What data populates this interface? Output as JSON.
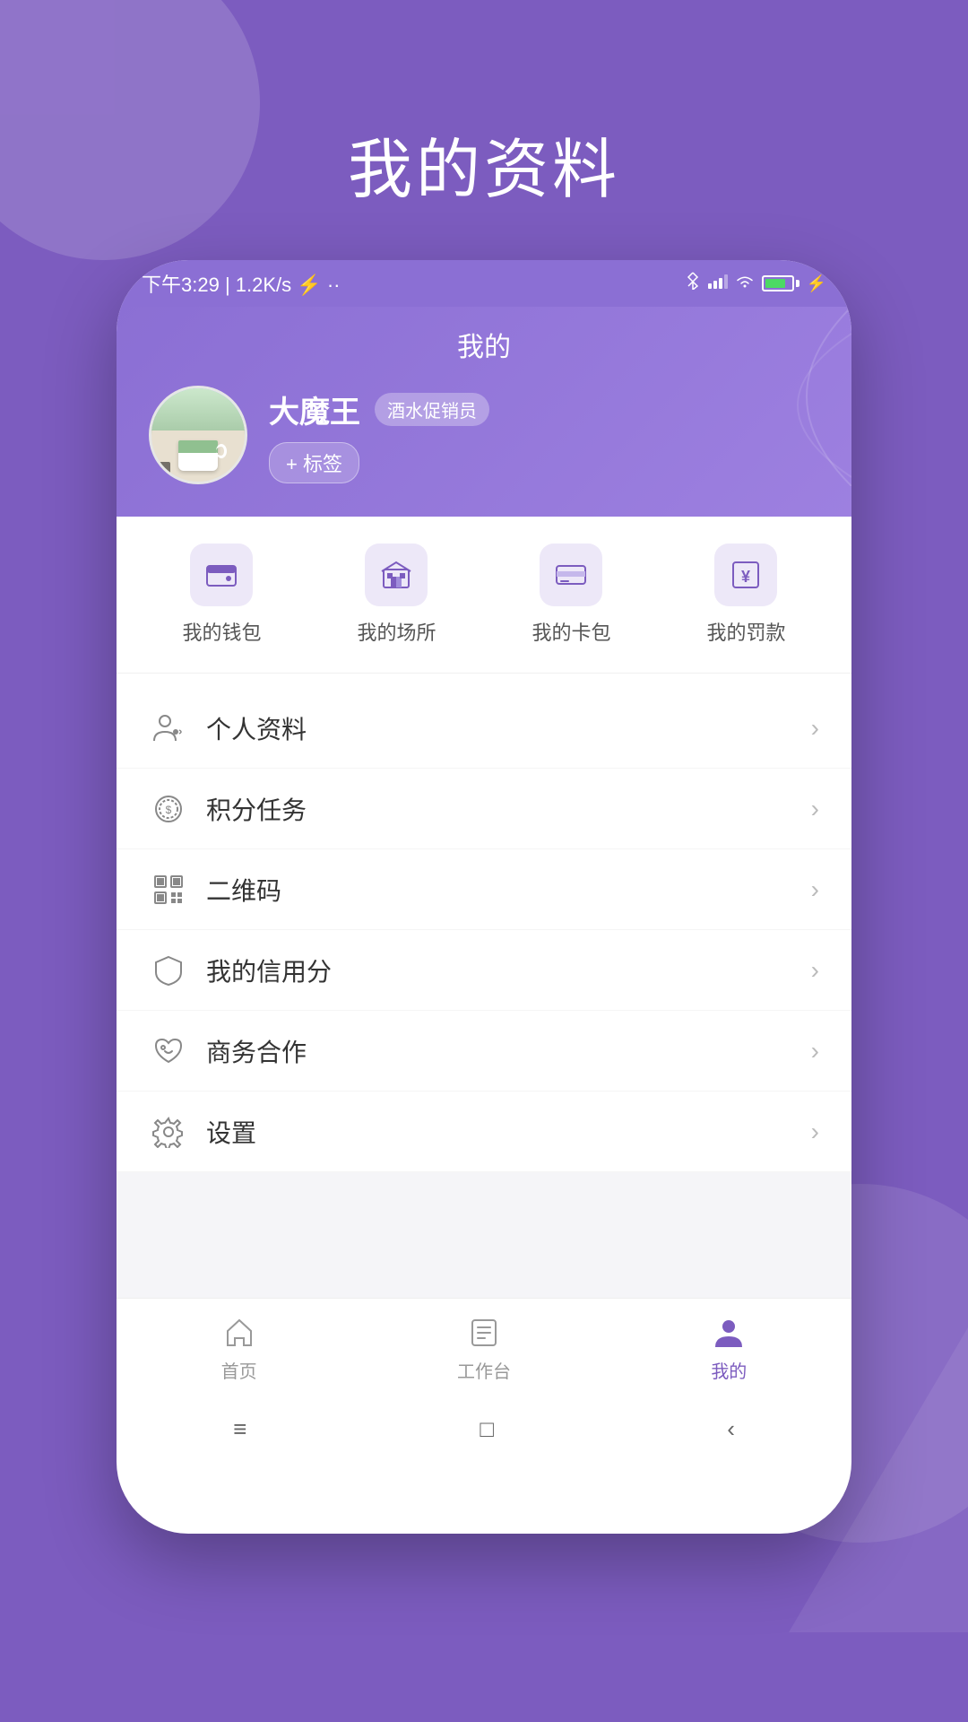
{
  "page": {
    "title": "我的资料",
    "background_color": "#7c5cbf"
  },
  "status_bar": {
    "time": "下午3:29",
    "network": "1.2K/s",
    "battery_percent": "87"
  },
  "profile_section": {
    "nav_title": "我的",
    "username": "大魔王",
    "role_badge": "酒水促销员",
    "tag_button": "+ 标签"
  },
  "quick_access": [
    {
      "id": "wallet",
      "label": "我的钱包",
      "icon": "wallet"
    },
    {
      "id": "venue",
      "label": "我的场所",
      "icon": "building"
    },
    {
      "id": "card",
      "label": "我的卡包",
      "icon": "card"
    },
    {
      "id": "fine",
      "label": "我的罚款",
      "icon": "yen"
    }
  ],
  "menu_items": [
    {
      "id": "profile",
      "label": "个人资料",
      "icon": "user"
    },
    {
      "id": "points",
      "label": "积分任务",
      "icon": "coin"
    },
    {
      "id": "qrcode",
      "label": "二维码",
      "icon": "qr"
    },
    {
      "id": "credit",
      "label": "我的信用分",
      "icon": "shield"
    },
    {
      "id": "business",
      "label": "商务合作",
      "icon": "heart"
    },
    {
      "id": "settings",
      "label": "设置",
      "icon": "gear"
    }
  ],
  "bottom_nav": [
    {
      "id": "home",
      "label": "首页",
      "active": false
    },
    {
      "id": "workspace",
      "label": "工作台",
      "active": false
    },
    {
      "id": "mine",
      "label": "我的",
      "active": true
    }
  ],
  "system_nav": {
    "menu_icon": "≡",
    "home_icon": "□",
    "back_icon": "‹"
  }
}
